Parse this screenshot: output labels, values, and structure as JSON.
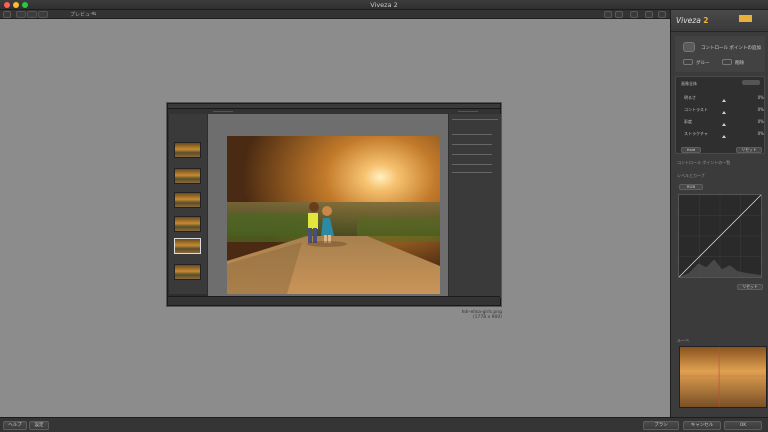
{
  "window": {
    "title": "Viveza 2",
    "traffic_colors": [
      "#ff5f57",
      "#febc2e",
      "#28c840"
    ]
  },
  "toolbar": {
    "preview_label": "プレビュー",
    "right_icons": [
      "zoom-icon",
      "compare-icon",
      "loupe-icon",
      "settings-icon",
      "help-icon"
    ]
  },
  "image": {
    "filename": "hdr-elisa-girls.png",
    "dimensions": "(1778 x 900)"
  },
  "panel": {
    "brand_name": "Viveza",
    "brand_version": "2",
    "add_control_point": "コントロール ポイントの追加",
    "group_label": "グルー",
    "delete_label": "削除",
    "global_adjust_label": "画像全体",
    "sliders": [
      {
        "label": "明るさ",
        "value": "0%"
      },
      {
        "label": "コントラスト",
        "value": "0%"
      },
      {
        "label": "彩度",
        "value": "0%"
      },
      {
        "label": "ストラクチャ",
        "value": "0%"
      }
    ],
    "reset_small_left": "Hold",
    "reset_small_right": "リセット",
    "control_point_list_label": "コントロール ポイントの一覧",
    "levels_curves_label": "レベルとカーブ",
    "channel_select": "RGB",
    "curve_reset": "リセット",
    "loupe_label": "ルーペ"
  },
  "bottom": {
    "help_button": "ヘルプ",
    "settings_button": "設定",
    "brush_button": "ブラシ",
    "cancel_button": "キャンセル",
    "ok_button": "OK"
  }
}
